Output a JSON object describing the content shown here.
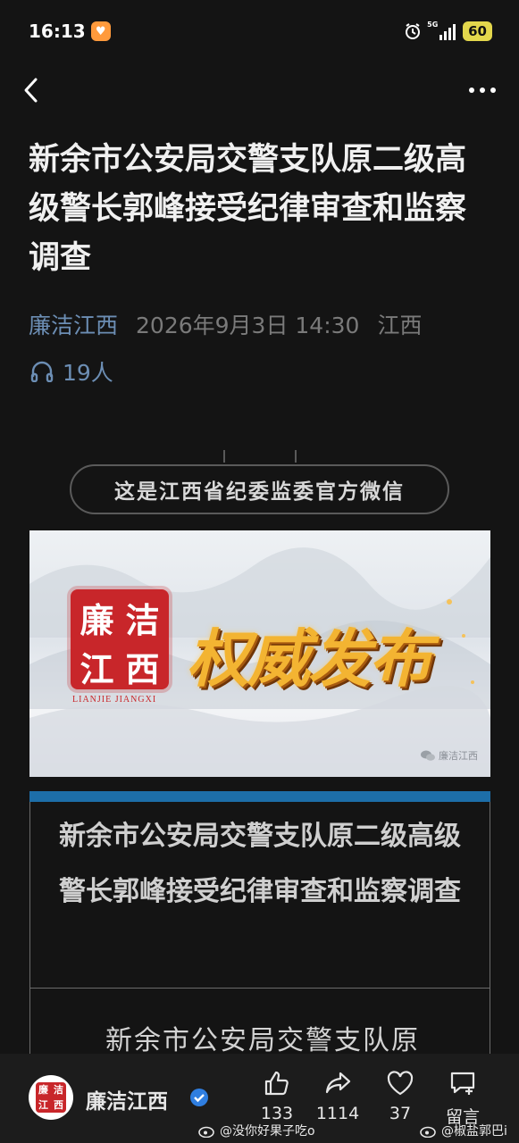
{
  "status_bar": {
    "time": "16:13",
    "network": "5G",
    "battery": "60"
  },
  "nav": {},
  "article": {
    "title": "新余市公安局交警支队原二级高级警长郭峰接受纪律审查和监察调查",
    "account": "廉洁江西",
    "datetime": "2026年9月3日 14:30",
    "location": "江西",
    "listeners": "19人"
  },
  "official_pill": "这是江西省纪委监委官方微信",
  "banner": {
    "seal_chars": [
      "廉",
      "洁",
      "江",
      "西"
    ],
    "seal_sub": "LIANJIE   JIANGXI",
    "headline": "权威发布",
    "watermark": "廉洁江西"
  },
  "content": {
    "heading": "新余市公安局交警支队原二级高级警长郭峰接受纪律审查和监察调查",
    "lead": "新余市公安局交警支队原"
  },
  "bottom_bar": {
    "account_name": "廉洁江西",
    "avatar_chars": [
      "廉",
      "洁",
      "江",
      "西"
    ],
    "like_count": "133",
    "share_count": "1114",
    "heart_count": "37",
    "comment_label": "留言"
  },
  "weibo_watermarks": {
    "left": "@没你好果子吃o",
    "right": "@椒盐郭巴i"
  },
  "colors": {
    "background": "#141414",
    "accent_link": "#6c8eb4",
    "seal_red": "#c8262a",
    "section_blue": "#1d6ea8",
    "gold": "#f3b432"
  }
}
